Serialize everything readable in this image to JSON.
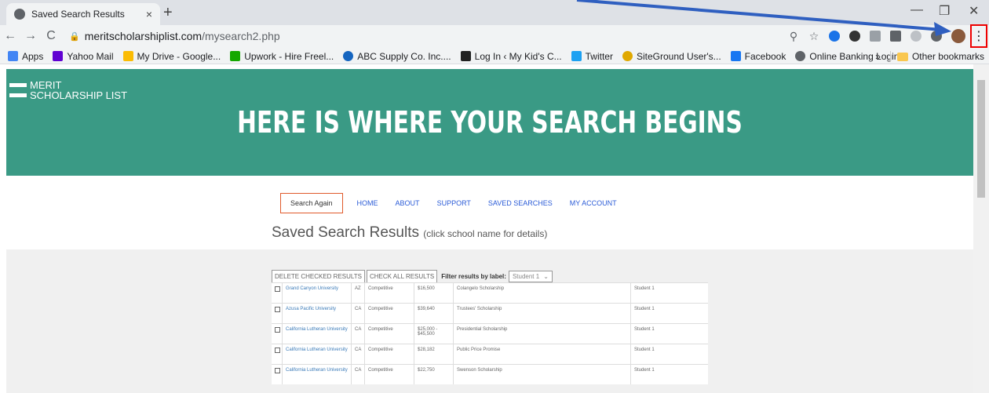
{
  "browser": {
    "tab_title": "Saved Search Results",
    "tab_close": "×",
    "new_tab": "+",
    "url_host": "meritscholarshiplist.com",
    "url_path": "/mysearch2.php",
    "menu_glyph": "⋮",
    "minimize": "—",
    "restore": "❐",
    "close": "✕",
    "bookmarks": [
      {
        "label": "Apps",
        "color": "#4285f4"
      },
      {
        "label": "Yahoo Mail",
        "color": "#6001d2"
      },
      {
        "label": "My Drive - Google...",
        "color": "#fbbc04"
      },
      {
        "label": "Upwork - Hire Freel...",
        "color": "#14a800"
      },
      {
        "label": "ABC Supply Co. Inc....",
        "color": "#1565c0"
      },
      {
        "label": "Log In ‹ My Kid's C...",
        "color": "#222222"
      },
      {
        "label": "Twitter",
        "color": "#1da1f2"
      },
      {
        "label": "SiteGround User's...",
        "color": "#e0a800"
      },
      {
        "label": "Facebook",
        "color": "#1877f2"
      },
      {
        "label": "Online Banking Login",
        "color": "#5f6368"
      }
    ],
    "more_bookmarks": "»",
    "other_bookmarks": "Other bookmarks"
  },
  "site": {
    "logo_line1": "MERIT",
    "logo_line2": "SCHOLARSHIP LIST",
    "hero_title": "HERE IS WHERE YOUR SEARCH BEGINS",
    "brand_color": "#3a9a85"
  },
  "nav": {
    "search_again": "Search Again",
    "home": "HOME",
    "about": "ABOUT",
    "support": "SUPPORT",
    "saved_searches": "SAVED SEARCHES",
    "my_account": "MY ACCOUNT"
  },
  "heading": {
    "title": "Saved Search Results",
    "subtitle": "(click school name for details)"
  },
  "controls": {
    "delete_checked": "DELETE CHECKED RESULTS",
    "check_all": "CHECK ALL RESULTS",
    "filter_label": "Filter results by label:",
    "filter_value": "Student 1"
  },
  "results": [
    {
      "school": "Grand Canyon University",
      "state": "AZ",
      "type": "Competitive",
      "amount": "$16,500",
      "scholarship": "Colangelo Scholarship",
      "label": "Student 1"
    },
    {
      "school": "Azusa Pacific University",
      "state": "CA",
      "type": "Competitive",
      "amount": "$39,640",
      "scholarship": "Trustees' Scholarship",
      "label": "Student 1"
    },
    {
      "school": "California Lutheran University",
      "state": "CA",
      "type": "Competitive",
      "amount": "$25,000 - $45,500",
      "scholarship": "Presidential Scholarship",
      "label": "Student 1"
    },
    {
      "school": "California Lutheran University",
      "state": "CA",
      "type": "Competitive",
      "amount": "$28,182",
      "scholarship": "Public Price Promise",
      "label": "Student 1"
    },
    {
      "school": "California Lutheran University",
      "state": "CA",
      "type": "Competitive",
      "amount": "$22,750",
      "scholarship": "Swenson Scholarship",
      "label": "Student 1"
    }
  ]
}
